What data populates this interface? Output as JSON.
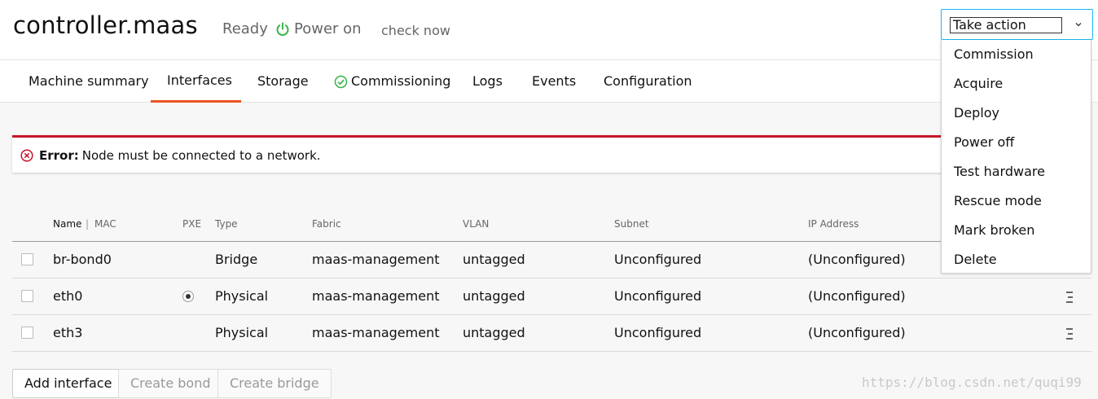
{
  "header": {
    "title": "controller.maas",
    "status": "Ready",
    "power": "Power on",
    "check_now": "check now"
  },
  "tabs": [
    {
      "label": "Machine summary"
    },
    {
      "label": "Interfaces",
      "active": true
    },
    {
      "label": "Storage"
    },
    {
      "label": "Commissioning",
      "icon": "check-circle-icon"
    },
    {
      "label": "Logs"
    },
    {
      "label": "Events"
    },
    {
      "label": "Configuration"
    }
  ],
  "error": {
    "label": "Error:",
    "message": "Node must be connected to a network."
  },
  "table": {
    "headers": {
      "name": "Name",
      "separator": "|",
      "mac": "MAC",
      "pxe": "PXE",
      "type": "Type",
      "fabric": "Fabric",
      "vlan": "VLAN",
      "subnet": "Subnet",
      "ip": "IP Address"
    },
    "rows": [
      {
        "name": "br-bond0",
        "pxe": false,
        "type": "Bridge",
        "fabric": "maas-management",
        "vlan": "untagged",
        "subnet": "Unconfigured",
        "ip": "(Unconfigured)"
      },
      {
        "name": "eth0",
        "pxe": true,
        "type": "Physical",
        "fabric": "maas-management",
        "vlan": "untagged",
        "subnet": "Unconfigured",
        "ip": "(Unconfigured)"
      },
      {
        "name": "eth3",
        "pxe": false,
        "type": "Physical",
        "fabric": "maas-management",
        "vlan": "untagged",
        "subnet": "Unconfigured",
        "ip": "(Unconfigured)"
      }
    ]
  },
  "buttons": {
    "add_interface": "Add interface",
    "create_bond": "Create bond",
    "create_bridge": "Create bridge"
  },
  "take_action": {
    "label": "Take action",
    "items": [
      "Commission",
      "Acquire",
      "Deploy",
      "Power off",
      "Test hardware",
      "Rescue mode",
      "Mark broken",
      "Delete"
    ]
  },
  "watermark": "https://blog.csdn.net/quqi99",
  "colors": {
    "accent": "#e95420",
    "error": "#c7162b",
    "power": "#38b44a",
    "focus": "#19b6ee"
  }
}
